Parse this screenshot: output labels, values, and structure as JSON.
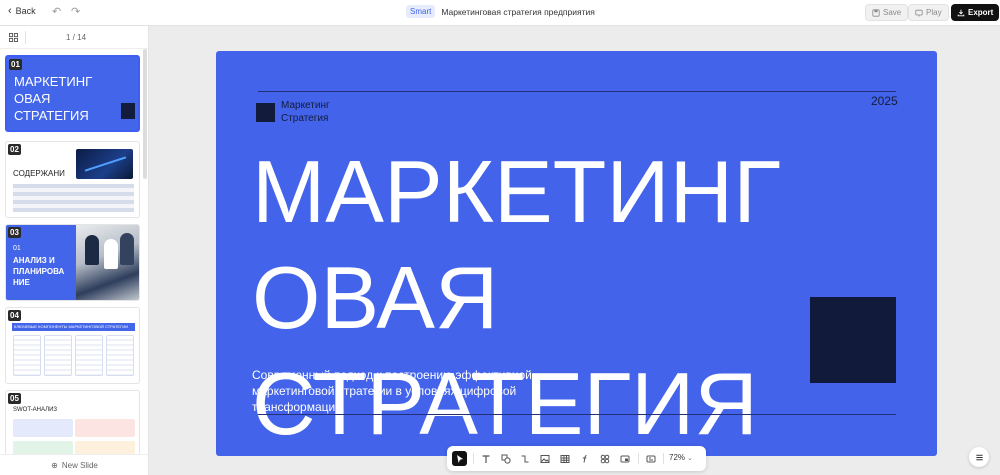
{
  "topbar": {
    "back_label": "Back",
    "smart_badge": "Smart",
    "document_title": "Маркетинговая стратегия предприятия",
    "save_label": "Save",
    "play_label": "Play",
    "export_label": "Export"
  },
  "sidebar": {
    "counter": "1 / 14",
    "new_slide_label": "New Slide",
    "thumbnails": [
      {
        "number": "01",
        "title": "МАРКЕТИНГ ОВАЯ СТРАТЕГИЯ"
      },
      {
        "number": "02",
        "title": "СОДЕРЖАНИ"
      },
      {
        "number": "03",
        "subtitle": "01",
        "title": "АНАЛИЗ И ПЛАНИРОВА НИЕ"
      },
      {
        "number": "04",
        "title": "КЛЮЧЕВЫЕ КОМПОНЕНТЫ МАРКЕТИНГОВОЙ СТРАТЕГИИ"
      },
      {
        "number": "05",
        "title": "SWOT-АНАЛИЗ"
      }
    ]
  },
  "slide": {
    "logo_text": "Маркетинг Стратегия",
    "year": "2025",
    "title": "МАРКЕТИНГ ОВАЯ СТРАТЕГИЯ",
    "subtitle": "Современный подход к построению эффективной маркетинговой стратегии в условиях цифровой трансформации"
  },
  "toolbar": {
    "tools": [
      "select-icon",
      "text-icon",
      "shapes-icon",
      "connector-icon",
      "image-icon",
      "table-icon",
      "formula-icon",
      "components-icon",
      "media-icon",
      "layout-icon"
    ],
    "zoom": "72%"
  },
  "colors": {
    "slide_bg": "#4263ea",
    "slide_dark": "#121b3c",
    "accent": "#3d64e8",
    "export_bg": "#111111"
  }
}
